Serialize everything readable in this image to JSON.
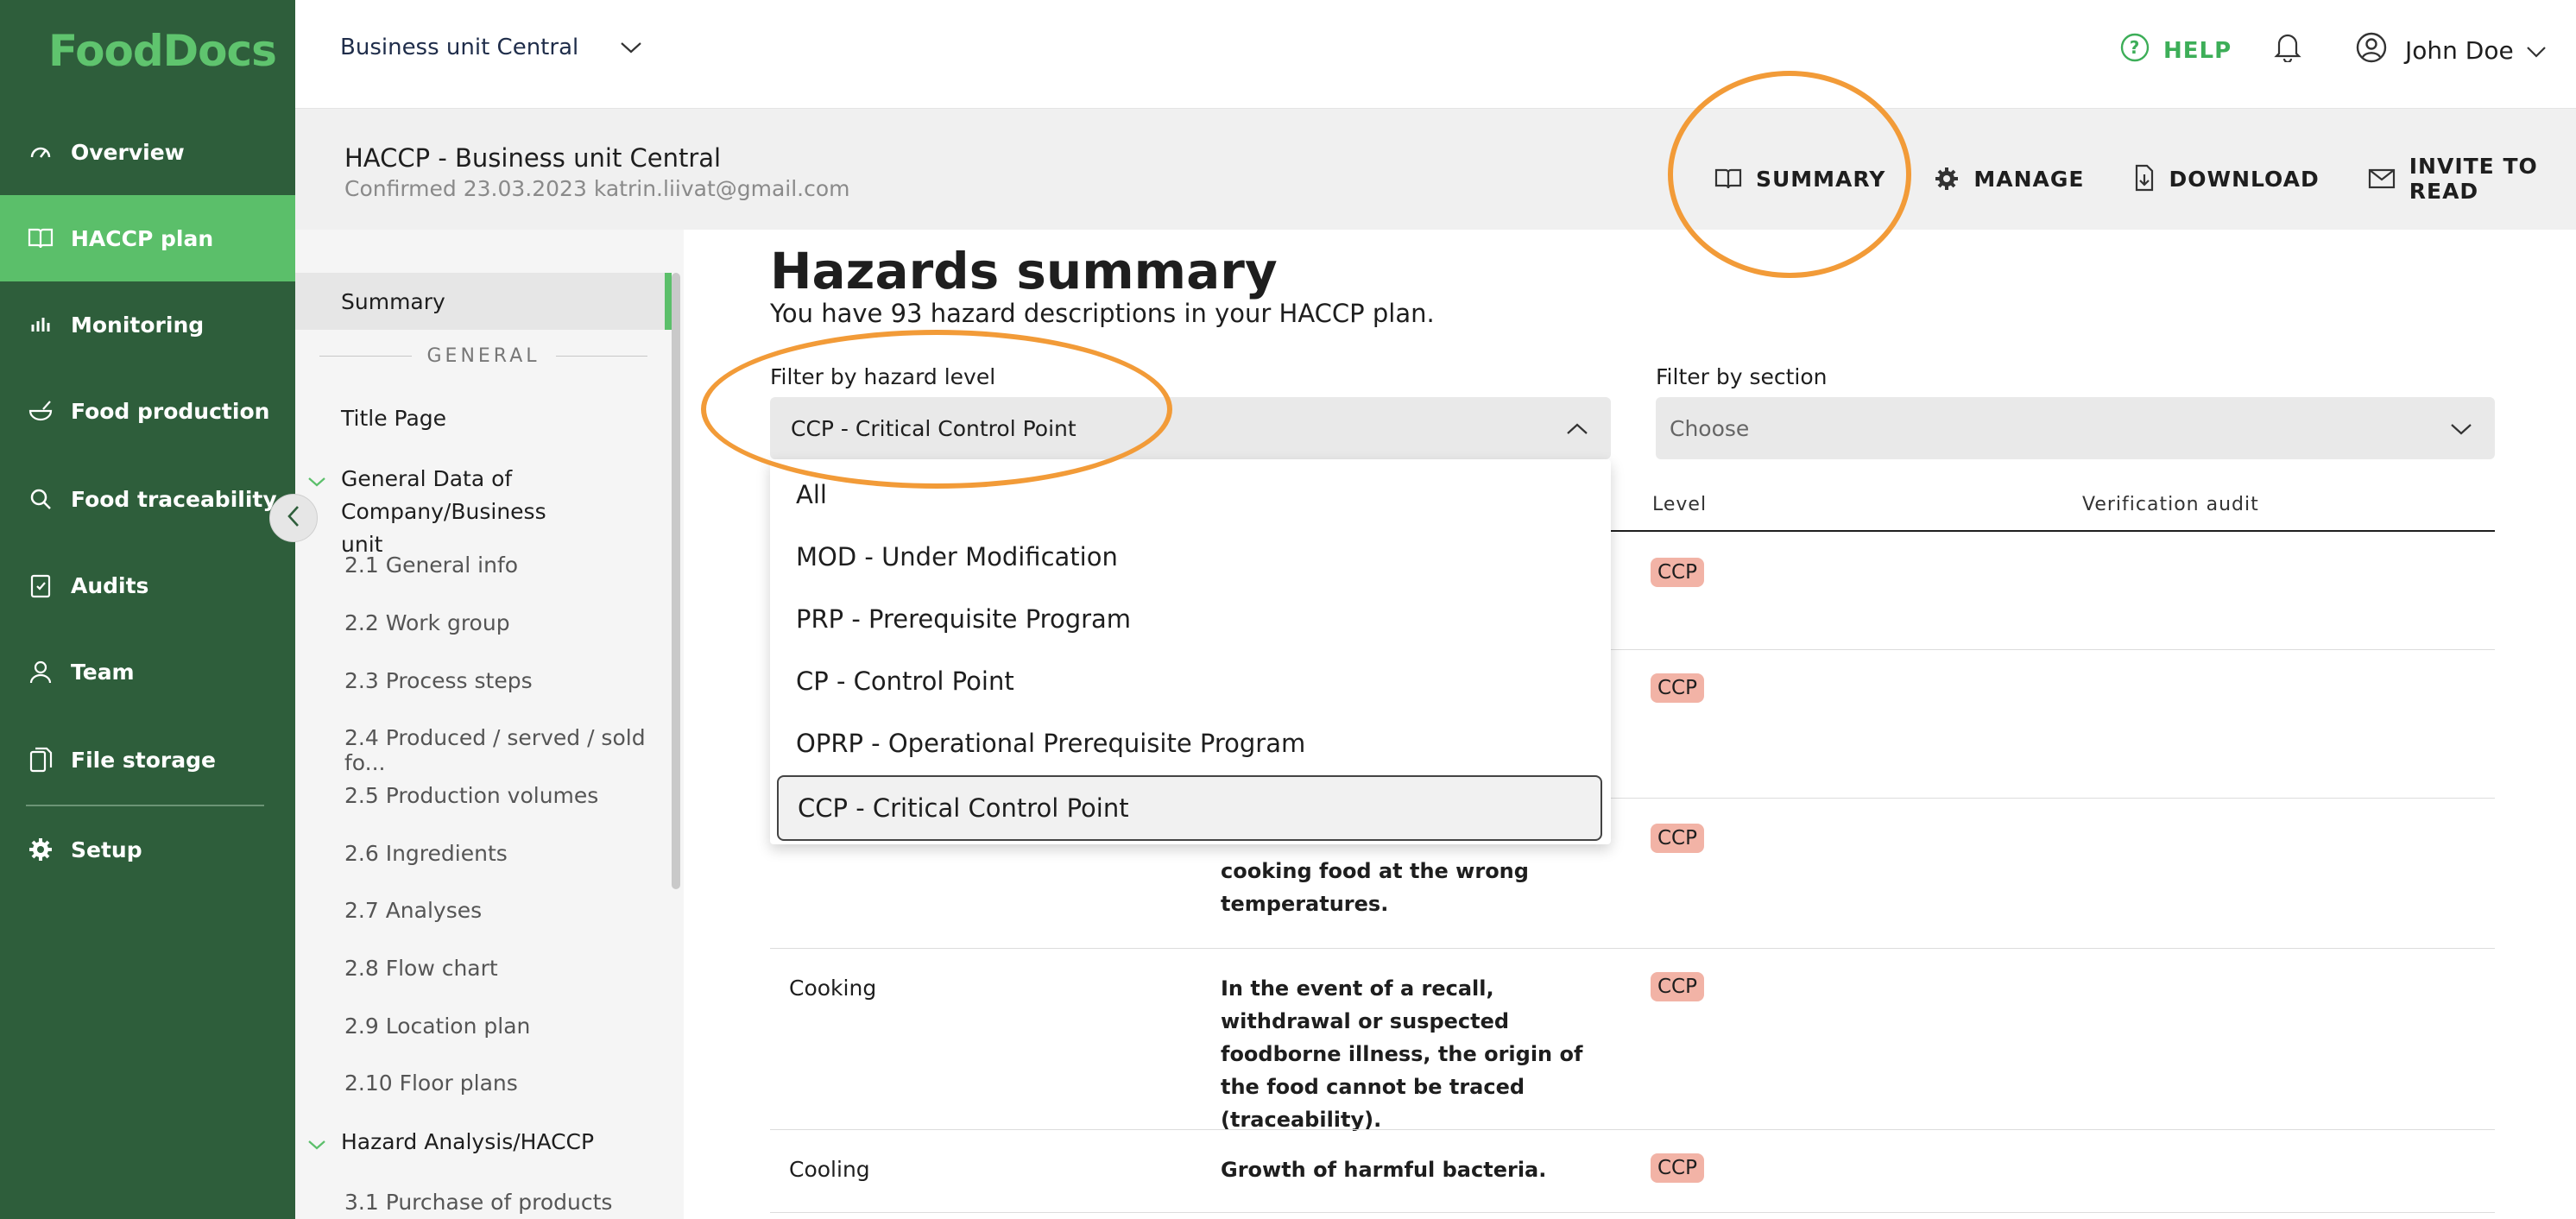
{
  "app": {
    "logo": "FoodDocs"
  },
  "sidebar": {
    "items": [
      {
        "label": "Overview",
        "icon": "gauge-icon"
      },
      {
        "label": "HACCP plan",
        "icon": "book-icon",
        "active": true
      },
      {
        "label": "Monitoring",
        "icon": "bar-chart-icon"
      },
      {
        "label": "Food production",
        "icon": "bowl-icon"
      },
      {
        "label": "Food traceability",
        "icon": "search-icon"
      },
      {
        "label": "Audits",
        "icon": "clipboard-icon"
      },
      {
        "label": "Team",
        "icon": "user-icon"
      },
      {
        "label": "File storage",
        "icon": "files-icon"
      },
      {
        "label": "Setup",
        "icon": "gear-icon"
      }
    ]
  },
  "topbar": {
    "business_unit": "Business unit Central",
    "help": "HELP",
    "user_name": "John Doe"
  },
  "subheader": {
    "title": "HACCP - Business unit Central",
    "subtitle": "Confirmed 23.03.2023 katrin.liivat@gmail.com",
    "actions": {
      "summary": "SUMMARY",
      "manage": "MANAGE",
      "download": "DOWNLOAD",
      "invite": "INVITE TO READ"
    }
  },
  "toc": {
    "summary": "Summary",
    "general_header": "GENERAL",
    "title_page": "Title Page",
    "general_data": "General Data of Company/Business unit",
    "subs": [
      "2.1 General info",
      "2.2 Work group",
      "2.3 Process steps",
      "2.4 Produced / served / sold fo...",
      "2.5 Production volumes",
      "2.6 Ingredients",
      "2.7 Analyses",
      "2.8 Flow chart",
      "2.9 Location plan",
      "2.10 Floor plans"
    ],
    "hazard_analysis": "Hazard Analysis/HACCP",
    "sub3_1": "3.1 Purchase of products"
  },
  "main": {
    "title": "Hazards summary",
    "description": "You have 93 hazard descriptions in your HACCP plan.",
    "filter_level_label": "Filter by hazard level",
    "filter_level_value": "CCP - Critical Control Point",
    "filter_section_label": "Filter by section",
    "filter_section_placeholder": "Choose",
    "columns": {
      "level": "Level",
      "verification": "Verification audit"
    },
    "rows": [
      {
        "step": "",
        "hazard": "",
        "level": "CCP"
      },
      {
        "step": "",
        "hazard": "",
        "level": "CCP"
      },
      {
        "step": "",
        "hazard": "cooking food at the wrong temperatures.",
        "level": "CCP"
      },
      {
        "step": "Cooking",
        "hazard": "In the event of a recall, withdrawal or suspected foodborne illness, the origin of the food cannot be traced (traceability).",
        "level": "CCP"
      },
      {
        "step": "Cooling",
        "hazard": "Growth of harmful bacteria.",
        "level": "CCP"
      }
    ]
  },
  "dropdown": {
    "options": [
      "All",
      "MOD - Under Modification",
      "PRP - Prerequisite Program",
      "CP - Control Point",
      "OPRP - Operational Prerequisite Program",
      "CCP - Critical Control Point"
    ],
    "selected": "CCP - Critical Control Point"
  },
  "colors": {
    "sidebar": "#2e5e3b",
    "accent_green": "#5bbf6a",
    "badge": "#f2b3a6",
    "annotation": "#f29b38"
  }
}
